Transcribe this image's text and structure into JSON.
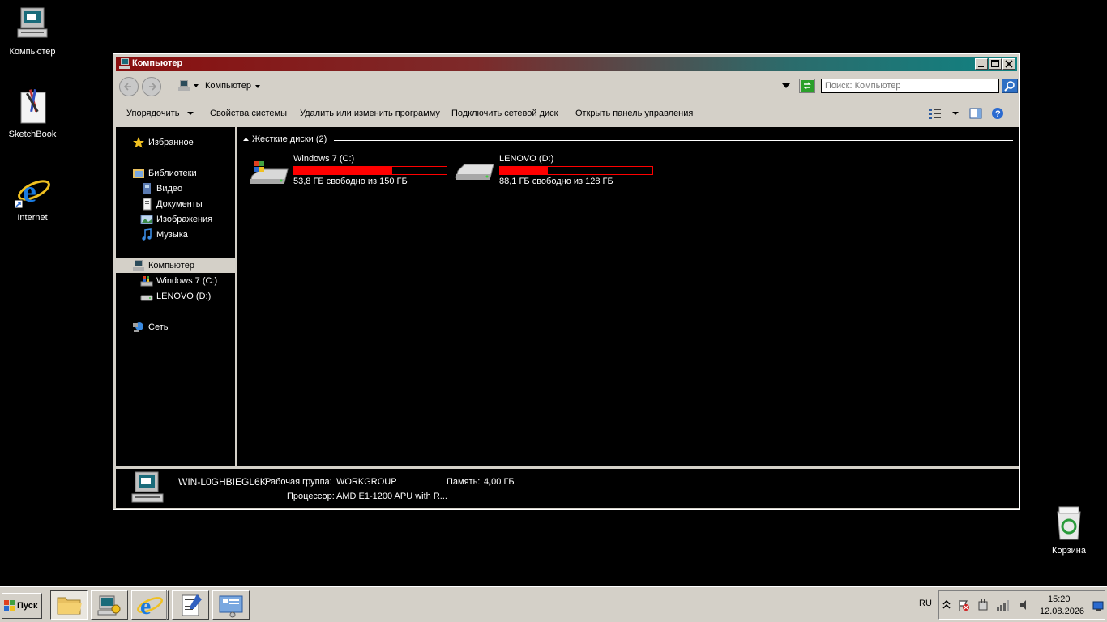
{
  "desktop": {
    "icons": [
      {
        "label": "Компьютер"
      },
      {
        "label": "SketchBook"
      },
      {
        "label": "Internet"
      },
      {
        "label": "Корзина"
      }
    ]
  },
  "window": {
    "title": "Компьютер",
    "address": {
      "location": "Компьютер",
      "search_placeholder": "Поиск: Компьютер"
    },
    "toolbar": {
      "organize": "Упорядочить",
      "system_properties": "Свойства системы",
      "uninstall": "Удалить или изменить программу",
      "map_drive": "Подключить сетевой диск",
      "control_panel": "Открыть панель управления"
    },
    "nav": {
      "favorites": "Избранное",
      "libraries": "Библиотеки",
      "video": "Видео",
      "documents": "Документы",
      "images": "Изображения",
      "music": "Музыка",
      "computer": "Компьютер",
      "drive_c": "Windows 7 (C:)",
      "drive_d": "LENOVO (D:)",
      "network": "Сеть"
    },
    "group_header": "Жесткие диски (2)",
    "drives": [
      {
        "name": "Windows 7 (C:)",
        "space": "53,8 ГБ свободно из 150 ГБ",
        "used_fraction": 0.641
      },
      {
        "name": "LENOVO (D:)",
        "space": "88,1 ГБ свободно из 128 ГБ",
        "used_fraction": 0.312
      }
    ],
    "details": {
      "computer_name": "WIN-L0GHBIEGL6K",
      "workgroup_label": "Рабочая группа:",
      "workgroup_value": "WORKGROUP",
      "memory_label": "Память:",
      "memory_value": "4,00 ГБ",
      "cpu_label": "Процессор:",
      "cpu_value": "AMD E1-1200 APU with R..."
    }
  },
  "taskbar": {
    "start_label": "Пуск",
    "language": "RU",
    "time": "15:20",
    "date": "12.08.2026"
  },
  "colors": {
    "title_left": "#8a0f0f",
    "title_right": "#0f8282",
    "bar": "#ff0000",
    "chrome": "#d4d0c8"
  }
}
